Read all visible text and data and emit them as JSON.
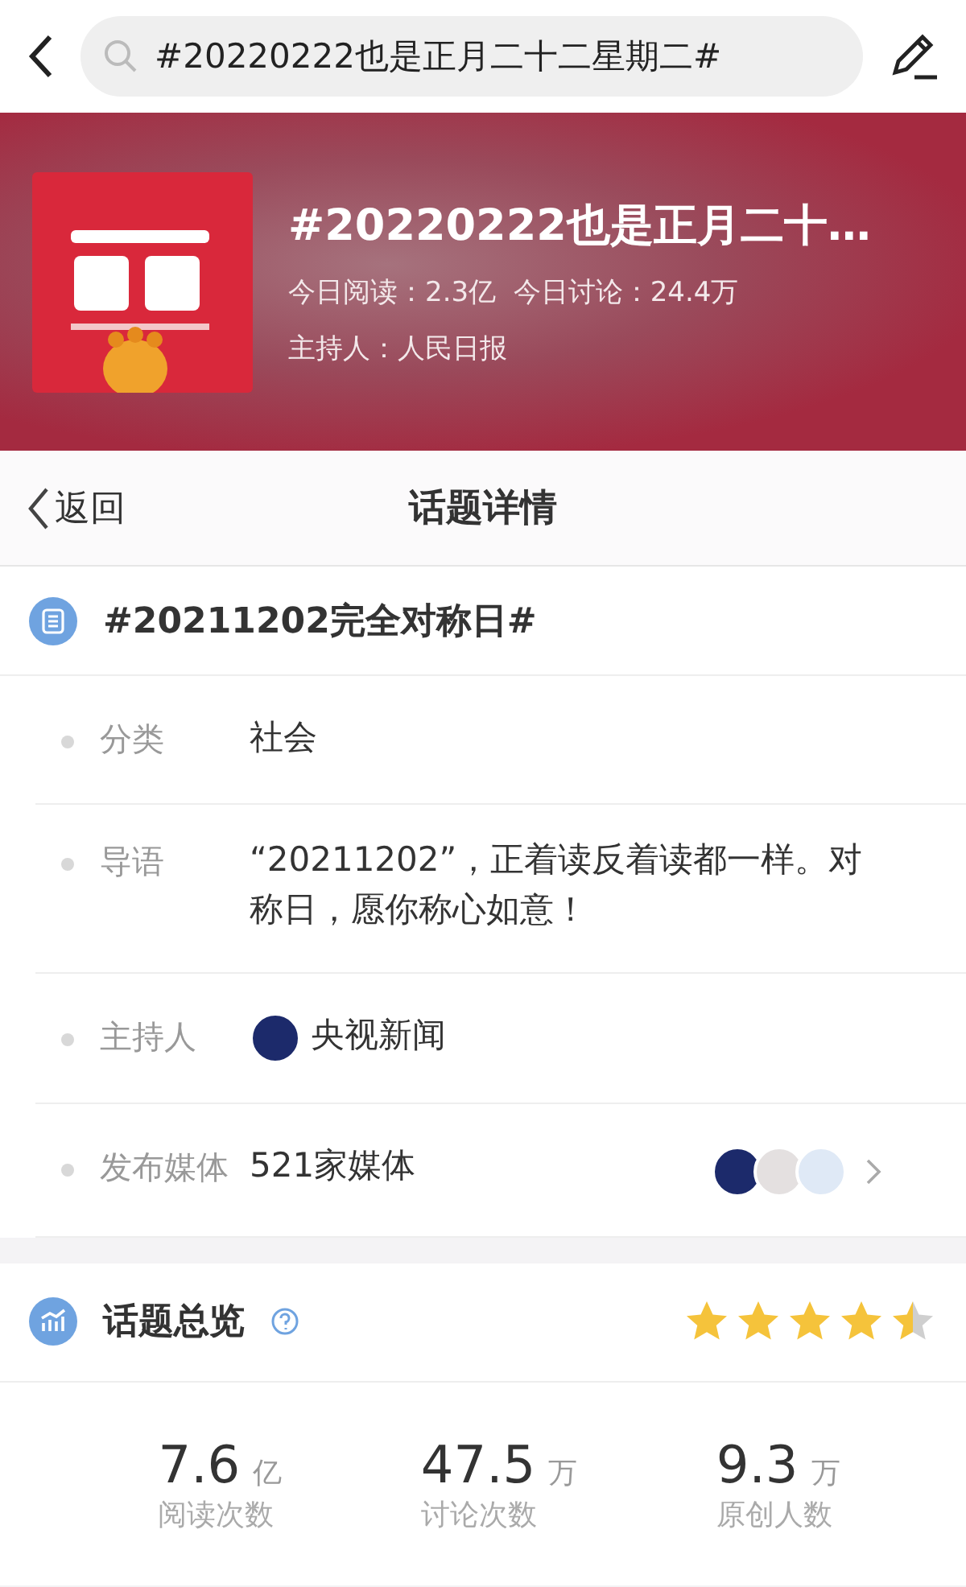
{
  "search": {
    "value": "#20220222也是正月二十二星期二#"
  },
  "banner": {
    "title": "#20220222也是正月二十…",
    "stats": "今日阅读：2.3亿  今日讨论：24.4万",
    "host": "主持人：人民日报"
  },
  "nav": {
    "back": "返回",
    "title": "话题详情"
  },
  "topic": {
    "title": "#20211202完全对称日#"
  },
  "details": [
    {
      "kind": "text",
      "label": "分类",
      "value": "社会"
    },
    {
      "kind": "text",
      "label": "导语",
      "value": "“20211202”，正着读反着读都一样。对称日，愿你称心如意！"
    },
    {
      "kind": "host",
      "label": "主持人",
      "value": "央视新闻"
    },
    {
      "kind": "media",
      "label": "发布媒体",
      "value": "521家媒体"
    }
  ],
  "overview": {
    "title": "话题总览",
    "stars": 4.5,
    "stats": [
      {
        "number": "7.6",
        "unit": "亿",
        "label": "阅读次数"
      },
      {
        "number": "47.5",
        "unit": "万",
        "label": "讨论次数"
      },
      {
        "number": "9.3",
        "unit": "万",
        "label": "原创人数"
      }
    ]
  }
}
